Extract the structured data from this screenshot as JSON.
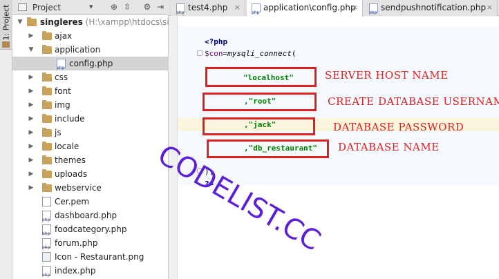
{
  "sidebar": {
    "tab_label": "1: Project"
  },
  "panel": {
    "title": "Project",
    "dropdown_glyph": "▾",
    "buttons": {
      "locate": "⊕",
      "collapse": "⇳",
      "settings": "⚙",
      "hide": "⇥"
    }
  },
  "tree": {
    "root_name": "singleres",
    "root_path": "(H:\\xampp\\htdocs\\singleres",
    "items": [
      {
        "label": "ajax"
      },
      {
        "label": "application"
      },
      {
        "label": "config.php"
      },
      {
        "label": "css"
      },
      {
        "label": "font"
      },
      {
        "label": "img"
      },
      {
        "label": "include"
      },
      {
        "label": "js"
      },
      {
        "label": "locale"
      },
      {
        "label": "themes"
      },
      {
        "label": "uploads"
      },
      {
        "label": "webservice"
      },
      {
        "label": "Cer.pem"
      },
      {
        "label": "dashboard.php"
      },
      {
        "label": "foodcategory.php"
      },
      {
        "label": "forum.php"
      },
      {
        "label": "Icon - Restaurant.png"
      },
      {
        "label": "index.php"
      }
    ]
  },
  "tabs": [
    {
      "label": "test4.php",
      "close": "×"
    },
    {
      "label": "application\\config.php",
      "close": "×"
    },
    {
      "label": "sendpushnotification.php",
      "close": "×"
    }
  ],
  "code": {
    "open_tag": "<?php",
    "con_var": "$con",
    "assign": "=",
    "fn_name": "mysqli_connect",
    "paren_open": "(",
    "host": "\"localhost\"",
    "user": ",\"root\"",
    "password": ",\"jack\"",
    "db": ",\"db_restaurant\"",
    "close_call": ");",
    "close_tag": "?>"
  },
  "annotations": {
    "server_host": "SERVER HOST NAME",
    "username": "CREATE DATABASE USERNAME",
    "password": "DATABASE PASSWORD",
    "dbname": "DATABASE NAME"
  },
  "watermark": "CODELIST.CC",
  "colors": {
    "annotation_red": "#e02020",
    "watermark_purple": "#5a1fd6",
    "string_green": "#008000",
    "keyword_navy": "#000080"
  }
}
